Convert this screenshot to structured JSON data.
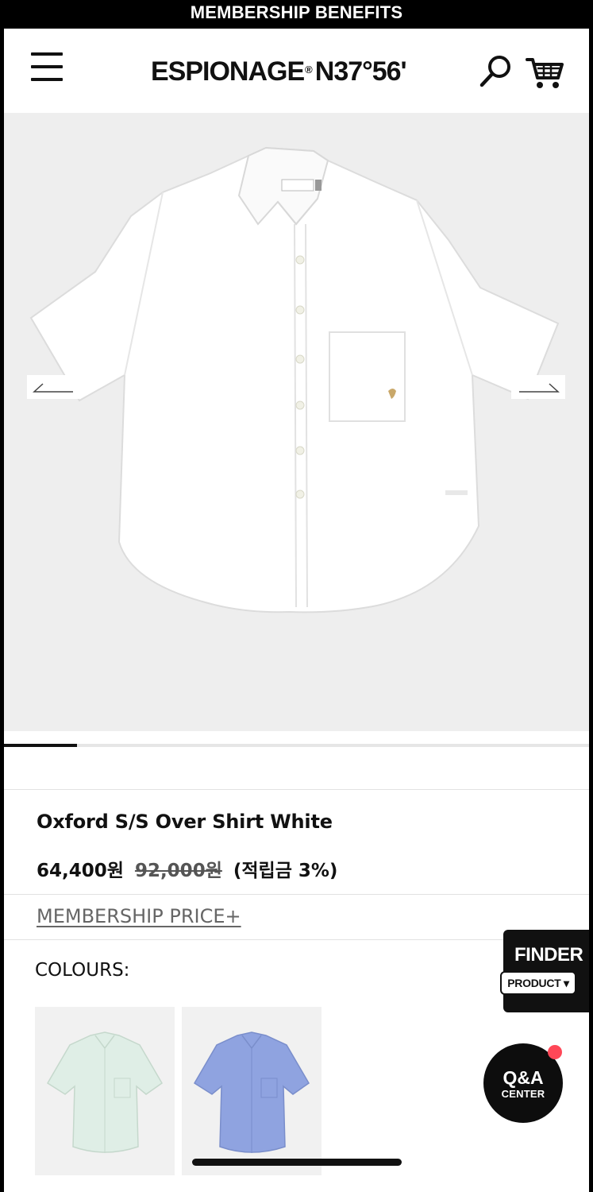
{
  "topbar": {
    "text": "MEMBERSHIP BENEFITS"
  },
  "header": {
    "logo_text": "ESPIONAGE",
    "logo_mark": "®",
    "logo_suffix": "N37°56'",
    "menu_icon": "hamburger-icon",
    "search_icon": "search-icon",
    "cart_icon": "cart-icon"
  },
  "gallery": {
    "image": "white-oxford-shirt",
    "prev_icon": "arrow-left-icon",
    "next_icon": "arrow-right-icon",
    "progress_fraction": 0.125,
    "colors": {
      "background": "#eeeeee",
      "progress": "#111111"
    }
  },
  "product": {
    "title": "Oxford S/S Over Shirt White",
    "price": "64,400원",
    "original_price": "92,000원",
    "points": "(적립금 3%)",
    "membership_link": "MEMBERSHIP PRICE+"
  },
  "colours": {
    "label": "COLOURS:",
    "options": [
      {
        "name": "mint",
        "color": "#dfeee6"
      },
      {
        "name": "blue",
        "color": "#8fa3e0"
      }
    ]
  },
  "finder": {
    "title": "FINDER",
    "pill": "PRODUCT ▾"
  },
  "qa": {
    "title": "Q&A",
    "subtitle": "CENTER",
    "badge_color": "#ff4757"
  }
}
